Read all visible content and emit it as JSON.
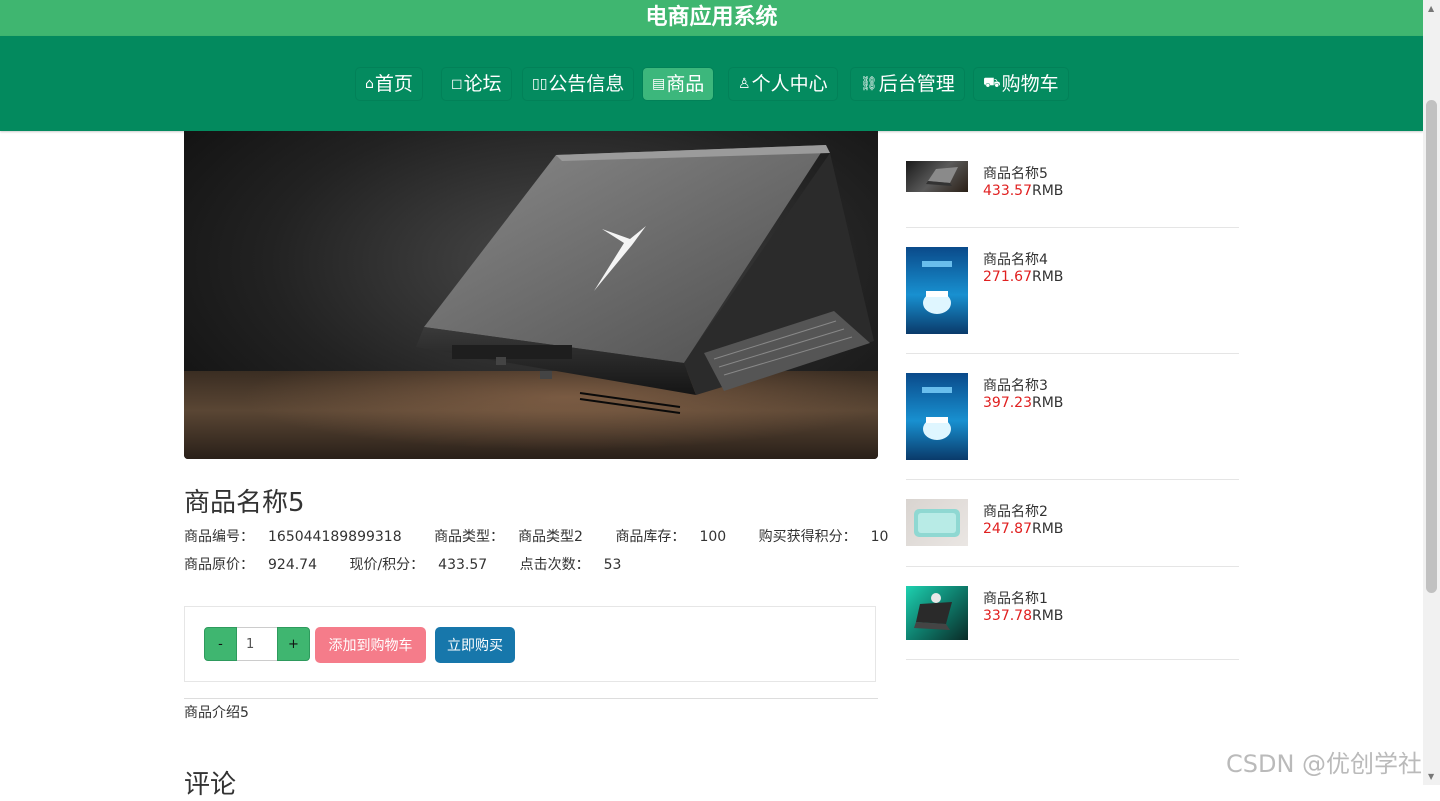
{
  "app_title": "电商应用系统",
  "nav": {
    "items": [
      {
        "icon": "home-icon",
        "glyph": "⌂",
        "label": "首页"
      },
      {
        "icon": "forum-icon",
        "glyph": "◻",
        "label": "论坛"
      },
      {
        "icon": "notice-icon",
        "glyph": "▯▯",
        "label": "公告信息"
      },
      {
        "icon": "product-icon",
        "glyph": "▤",
        "label": "商品"
      },
      {
        "icon": "user-icon",
        "glyph": "♙",
        "label": "个人中心"
      },
      {
        "icon": "link-icon",
        "glyph": "⛓",
        "label": "后台管理"
      },
      {
        "icon": "cart-icon",
        "glyph": "⛟",
        "label": "购物车"
      }
    ],
    "active_label": "商品"
  },
  "product": {
    "title": "商品名称5",
    "code_label": "商品编号：",
    "code": "165044189899318",
    "type_label": "商品类型：",
    "type": "商品类型2",
    "stock_label": "商品库存：",
    "stock": "100",
    "points_label": "购买获得积分：",
    "points": "10",
    "orig_price_label": "商品原价：",
    "orig_price": "924.74",
    "cur_price_label": "现价/积分：",
    "cur_price": "433.57",
    "clicks_label": "点击次数：",
    "clicks": "53",
    "intro": "商品介绍5"
  },
  "buy": {
    "minus": "-",
    "plus": "+",
    "qty": "1",
    "add_cart": "添加到购物车",
    "buy_now": "立即购买"
  },
  "review_title": "评论",
  "sidebar": {
    "currency": "RMB",
    "items": [
      {
        "name": "商品名称5",
        "price": "433.57"
      },
      {
        "name": "商品名称4",
        "price": "271.67"
      },
      {
        "name": "商品名称3",
        "price": "397.23"
      },
      {
        "name": "商品名称2",
        "price": "247.87"
      },
      {
        "name": "商品名称1",
        "price": "337.78"
      }
    ]
  },
  "watermark": "CSDN @优创学社",
  "colors": {
    "topbar": "#3fb670",
    "navbar": "#038a5e",
    "nav_active": "#3cb77c",
    "price_red": "#e02020",
    "cart_button": "#f57c8a",
    "buy_button": "#1777ab"
  }
}
